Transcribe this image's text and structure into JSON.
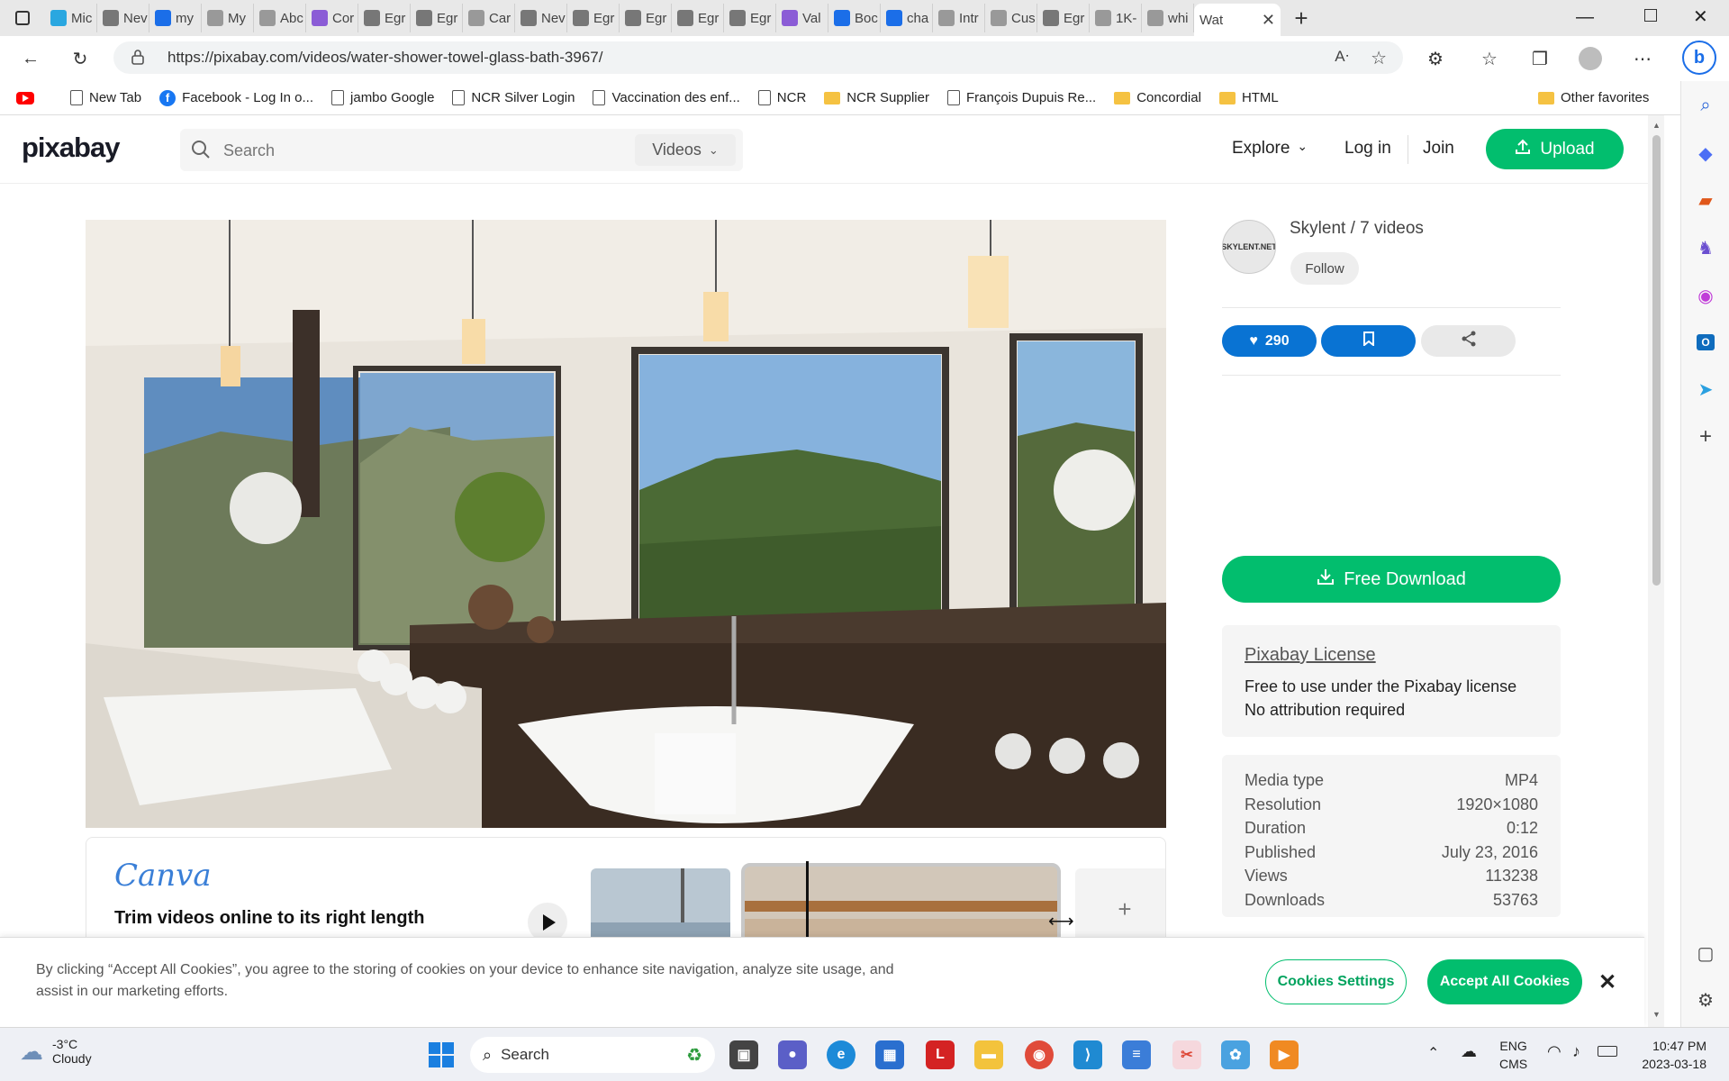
{
  "browser": {
    "tabs": [
      {
        "label": "Mic",
        "icon": "edge-icon"
      },
      {
        "label": "Nev",
        "icon": "newtab-icon"
      },
      {
        "label": "my",
        "icon": "search-icon"
      },
      {
        "label": "My",
        "icon": "site-icon"
      },
      {
        "label": "Abc",
        "icon": "site-icon"
      },
      {
        "label": "Cor",
        "icon": "b-icon"
      },
      {
        "label": "Egr",
        "icon": "page-icon"
      },
      {
        "label": "Egr",
        "icon": "page-icon"
      },
      {
        "label": "Car",
        "icon": "site-icon"
      },
      {
        "label": "Nev",
        "icon": "newtab-icon"
      },
      {
        "label": "Egr",
        "icon": "page-icon"
      },
      {
        "label": "Egr",
        "icon": "page-icon"
      },
      {
        "label": "Egr",
        "icon": "page-icon"
      },
      {
        "label": "Egr",
        "icon": "page-icon"
      },
      {
        "label": "Val",
        "icon": "b-icon"
      },
      {
        "label": "Boc",
        "icon": "bolt-icon"
      },
      {
        "label": "cha",
        "icon": "search-icon"
      },
      {
        "label": "Intr",
        "icon": "site-icon"
      },
      {
        "label": "Cus",
        "icon": "site-icon"
      },
      {
        "label": "Egr",
        "icon": "page-icon"
      },
      {
        "label": "1K-",
        "icon": "site-icon"
      },
      {
        "label": "whi",
        "icon": "site-icon"
      }
    ],
    "active_tab": "Wat",
    "url": "https://pixabay.com/videos/water-shower-towel-glass-bath-3967/"
  },
  "favorites": [
    {
      "label": "New Tab",
      "type": "page"
    },
    {
      "label": "Facebook - Log In o...",
      "type": "facebook"
    },
    {
      "label": "jambo Google",
      "type": "page"
    },
    {
      "label": "NCR Silver Login",
      "type": "page"
    },
    {
      "label": "Vaccination des enf...",
      "type": "page"
    },
    {
      "label": "NCR",
      "type": "page"
    },
    {
      "label": "NCR Supplier",
      "type": "folder"
    },
    {
      "label": "François Dupuis Re...",
      "type": "page"
    },
    {
      "label": "Concordial",
      "type": "folder"
    },
    {
      "label": "HTML",
      "type": "folder"
    }
  ],
  "other_favorites": "Other favorites",
  "site": {
    "logo": "pixabay",
    "search_placeholder": "Search",
    "search_scope": "Videos",
    "nav": {
      "explore": "Explore",
      "login": "Log in",
      "join": "Join",
      "upload": "Upload"
    }
  },
  "author": {
    "line": "Skylent / 7 videos",
    "avatar_text": "SKYLENT.NET",
    "follow": "Follow"
  },
  "actions": {
    "likes": "290"
  },
  "download": {
    "label": "Free Download"
  },
  "license": {
    "title": "Pixabay License",
    "line1": "Free to use under the Pixabay license",
    "line2": "No attribution required"
  },
  "meta": [
    {
      "label": "Media type",
      "value": "MP4"
    },
    {
      "label": "Resolution",
      "value": "1920×1080"
    },
    {
      "label": "Duration",
      "value": "0:12"
    },
    {
      "label": "Published",
      "value": "July 23, 2016"
    },
    {
      "label": "Views",
      "value": "113238"
    },
    {
      "label": "Downloads",
      "value": "53763"
    }
  ],
  "canva": {
    "logo": "Canva",
    "headline": "Trim videos online to its right length"
  },
  "cookie": {
    "text": "By clicking “Accept All Cookies”, you agree to the storing of cookies on your device to enhance site navigation, analyze site usage, and assist in our marketing efforts.",
    "settings": "Cookies Settings",
    "accept": "Accept All Cookies"
  },
  "taskbar": {
    "weather_temp": "-3°C",
    "weather_desc": "Cloudy",
    "search": "Search",
    "lang1": "ENG",
    "lang2": "CMS",
    "time": "10:47 PM",
    "date": "2023-03-18"
  },
  "colors": {
    "brand_green": "#02be6e",
    "action_blue": "#0973d3"
  }
}
